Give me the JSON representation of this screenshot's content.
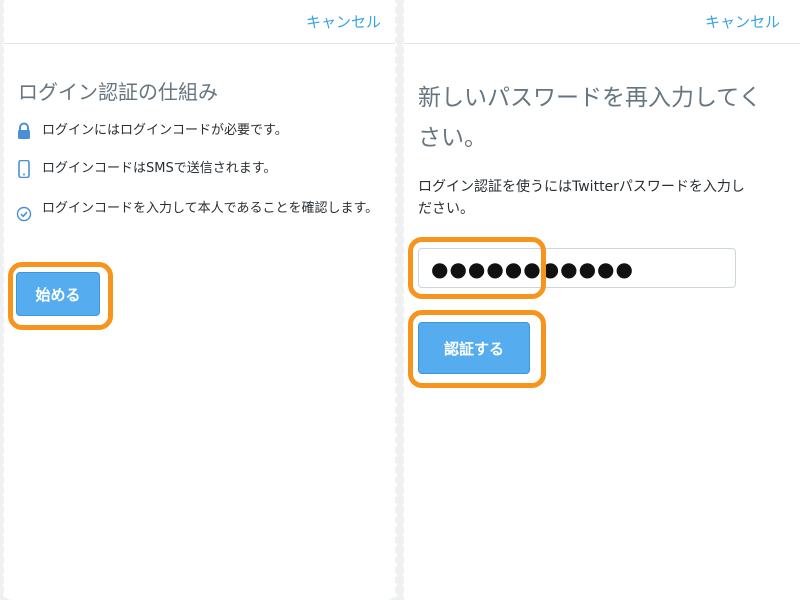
{
  "left_panel": {
    "cancel_label": "キャンセル",
    "title": "ログイン認証の仕組み",
    "features": [
      {
        "icon": "lock-icon",
        "text": "ログインにはログインコードが必要です。"
      },
      {
        "icon": "phone-icon",
        "text": "ログインコードはSMSで送信されます。"
      },
      {
        "icon": "check-circle-icon",
        "text": "ログインコードを入力して本人であることを確認します。"
      }
    ],
    "start_button": "始める"
  },
  "right_panel": {
    "cancel_label": "キャンセル",
    "title_line1": "新しいパスワードを再入力してく",
    "title_line2": "さい。",
    "description_line1": "ログイン認証を使うにはTwitterパスワードを入力し",
    "description_line2": "ださい。",
    "password_value": "●●●●●●●●●●●",
    "verify_button": "認証する"
  },
  "colors": {
    "accent_blue": "#55acee",
    "link_blue": "#3aa3e3",
    "highlight_orange": "#f7941d"
  }
}
